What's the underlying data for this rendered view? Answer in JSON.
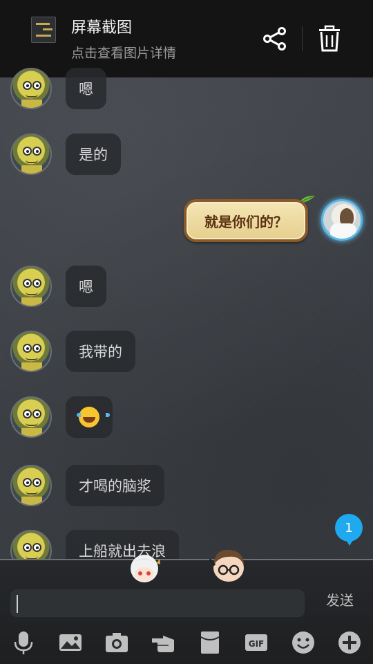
{
  "notification": {
    "title": "屏幕截图",
    "subtitle": "点击查看图片详情"
  },
  "messages": [
    {
      "side": "left",
      "text": "嗯"
    },
    {
      "side": "left",
      "text": "是的"
    },
    {
      "side": "right",
      "text": "就是你们的？"
    },
    {
      "side": "left",
      "text": "嗯"
    },
    {
      "side": "left",
      "text": "我带的"
    },
    {
      "side": "left",
      "text": "",
      "emoji": "tears-of-joy-emoji"
    },
    {
      "side": "left",
      "text": "才喝的脑浆"
    },
    {
      "side": "left",
      "text": "上船就出去浪"
    }
  ],
  "unread_count": "1",
  "input": {
    "value": "",
    "send_label": "发送"
  },
  "toolbar": {
    "items": [
      "microphone-icon",
      "image-icon",
      "camera-icon",
      "poke-icon",
      "red-packet-icon",
      "gif-icon",
      "emoji-icon",
      "plus-icon"
    ],
    "gif_label": "GIF"
  },
  "colors": {
    "header_bg": "#141414",
    "bubble_bg": "#282a2e",
    "my_bubble_bg": "#f4e6b5",
    "unread_badge": "#1fa9ef"
  }
}
